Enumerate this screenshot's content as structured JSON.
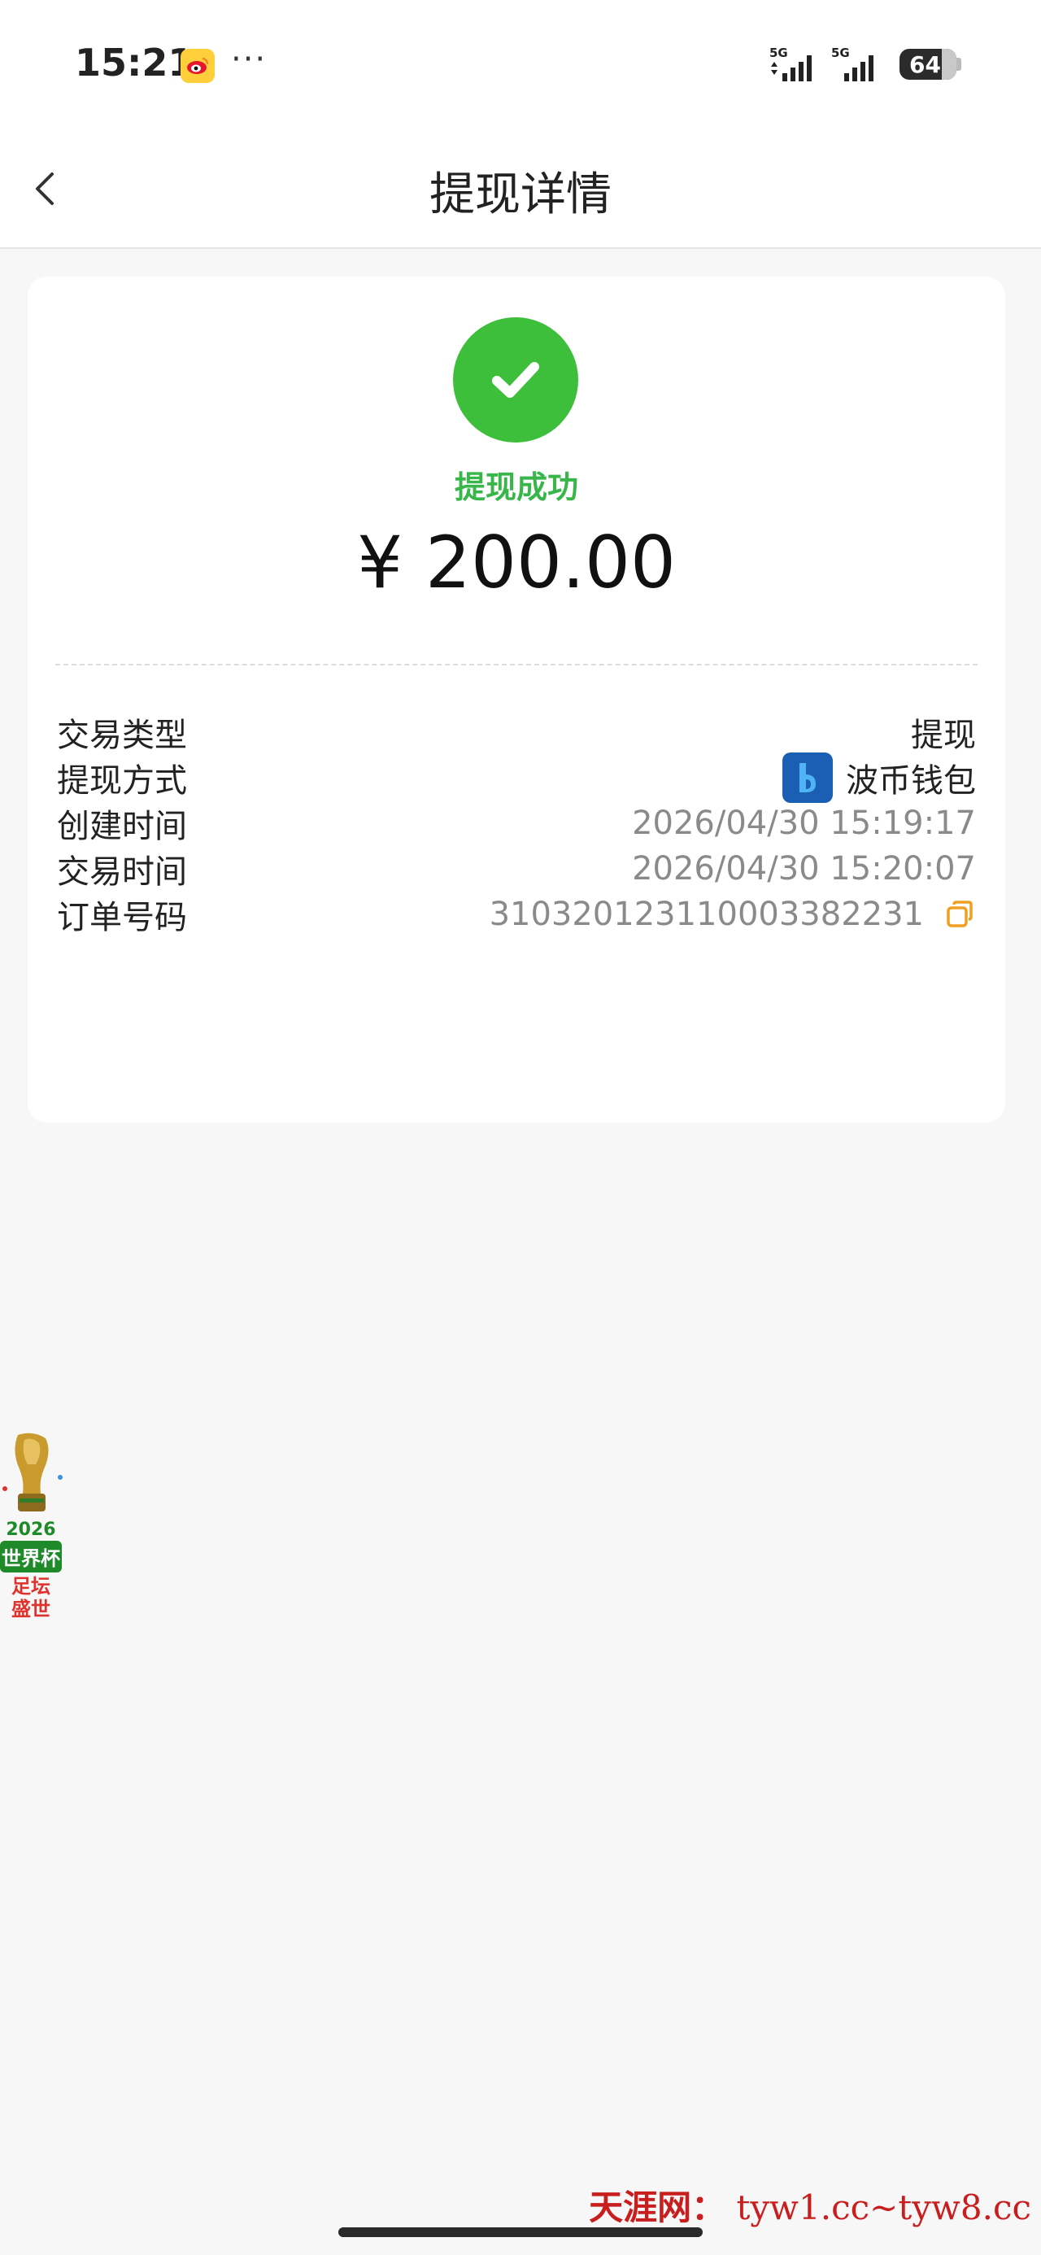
{
  "status_bar": {
    "time": "15:21",
    "notification_dots": "···",
    "signal_1_label": "5G",
    "signal_2_label": "5G",
    "battery": "64"
  },
  "nav": {
    "title": "提现详情"
  },
  "result": {
    "status_text": "提现成功",
    "amount": "¥ 200.00",
    "status_color": "#3dbf3b"
  },
  "details": [
    {
      "label": "交易类型",
      "value": "提现"
    },
    {
      "label": "提现方式",
      "value": "波币钱包"
    },
    {
      "label": "创建时间",
      "value": "2026/04/30 15:19:17"
    },
    {
      "label": "交易时间",
      "value": "2026/04/30 15:20:07"
    },
    {
      "label": "订单号码",
      "value": "31032012311000338223​1"
    }
  ],
  "promo": {
    "year": "2026",
    "cup": "世界杯",
    "slogan_1": "足坛",
    "slogan_2": "盛世"
  },
  "watermark": {
    "brand": "天涯网：",
    "domains": "tyw1.cc~tyw8.cc"
  }
}
